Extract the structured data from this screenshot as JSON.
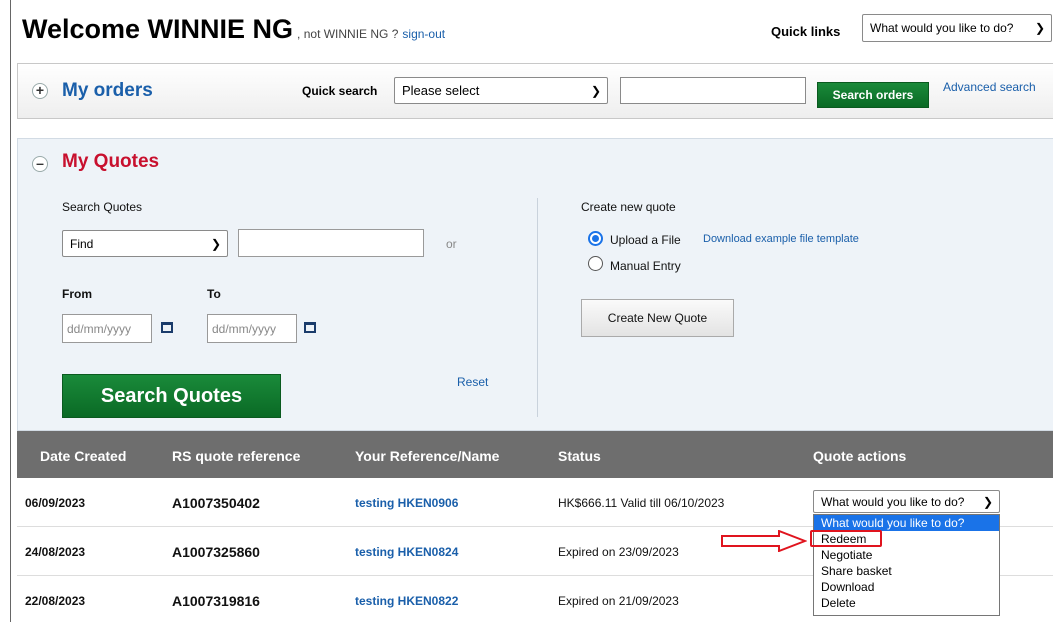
{
  "header": {
    "welcome": "Welcome WINNIE NG",
    "not_user": ", not WINNIE NG ?",
    "sign_out": "sign-out",
    "quick_links_label": "Quick links",
    "quick_links_value": "What would you like to do?"
  },
  "orders": {
    "title": "My orders",
    "quick_search_label": "Quick search",
    "quick_search_value": "Please select",
    "search_button": "Search orders",
    "advanced_search": "Advanced search"
  },
  "quotes": {
    "title": "My Quotes",
    "search_label": "Search Quotes",
    "find_value": "Find",
    "or_label": "or",
    "from_label": "From",
    "to_label": "To",
    "date_placeholder": "dd/mm/yyyy",
    "search_button": "Search Quotes",
    "reset": "Reset",
    "create_label": "Create new quote",
    "upload_option": "Upload a File",
    "template_link": "Download example file template",
    "manual_option": "Manual Entry",
    "create_button": "Create New Quote"
  },
  "table": {
    "headers": [
      "Date Created",
      "RS quote reference",
      "Your Reference/Name",
      "Status",
      "Quote actions"
    ],
    "rows": [
      {
        "date": "06/09/2023",
        "ref": "A1007350402",
        "name": "testing HKEN0906",
        "status": "HK$666.11 Valid till 06/10/2023"
      },
      {
        "date": "24/08/2023",
        "ref": "A1007325860",
        "name": "testing HKEN0824",
        "status": "Expired on 23/09/2023"
      },
      {
        "date": "22/08/2023",
        "ref": "A1007319816",
        "name": "testing HKEN0822",
        "status": "Expired on 21/09/2023"
      }
    ],
    "action_select_value": "What would you like to do?",
    "action_options": [
      "What would you like to do?",
      "Redeem",
      "Negotiate",
      "Share basket",
      "Download",
      "Delete"
    ]
  },
  "colors": {
    "accent_blue": "#1a5faa",
    "quotes_red": "#c8102e",
    "green_button": "#0a6a25",
    "annotation_red": "#e0141e"
  }
}
